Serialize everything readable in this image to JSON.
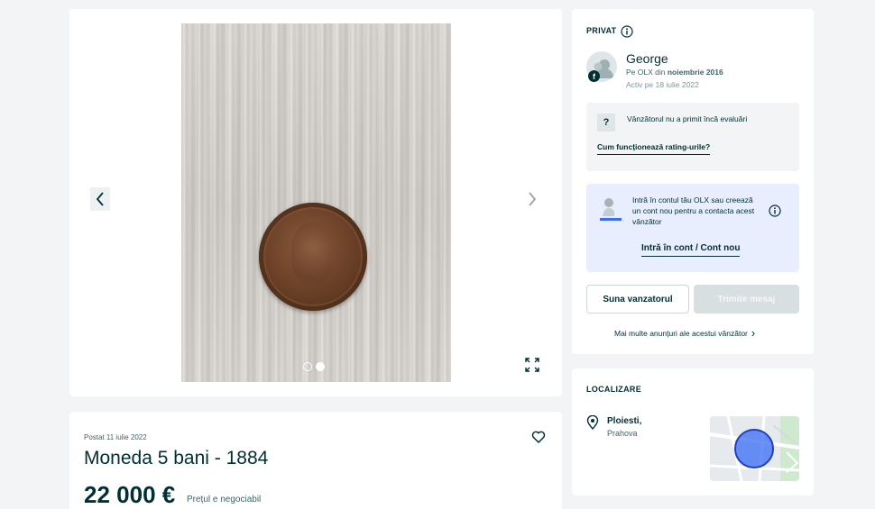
{
  "gallery": {
    "image_alt": "Moneda 5 bani - 1884",
    "slides_total": 2,
    "active_slide": 2,
    "icons": {
      "prev": "chevron-left-icon",
      "next": "chevron-right-icon",
      "fullscreen": "expand-icon"
    }
  },
  "ad": {
    "posted": "Postat 11 iulie 2022",
    "title": "Moneda 5 bani - 1884",
    "price": "22 000 €",
    "negotiable": "Prețul e negociabil",
    "favorite_icon": "heart-icon"
  },
  "seller": {
    "type_label": "PRIVAT",
    "name": "George",
    "since_prefix": "Pe OLX din ",
    "since_date": "noiembrie 2016",
    "active": "Activ pe 18 iulie 2022",
    "facebook_badge": "f",
    "rating": {
      "question_mark": "?",
      "text": "Vânzătorul nu a primit încă evaluări",
      "link": "Cum funcționează rating-urile?"
    },
    "login": {
      "text": "Intră în contul tău OLX sau creează un cont nou pentru a contacta acest vânzător",
      "link": "Intră în cont / Cont nou"
    },
    "call_button": "Suna vanzatorul",
    "message_button": "Trimite mesaj",
    "more_ads": "Mai multe anunțuri ale acestui vânzător",
    "more_ads_arrow": "›"
  },
  "location": {
    "title": "LOCALIZARE",
    "city": "Ploiesti,",
    "region": "Prahova"
  },
  "colors": {
    "primary": "#002f34",
    "login_bg": "#e9eefe",
    "map_circle": "#3a6cf4"
  }
}
